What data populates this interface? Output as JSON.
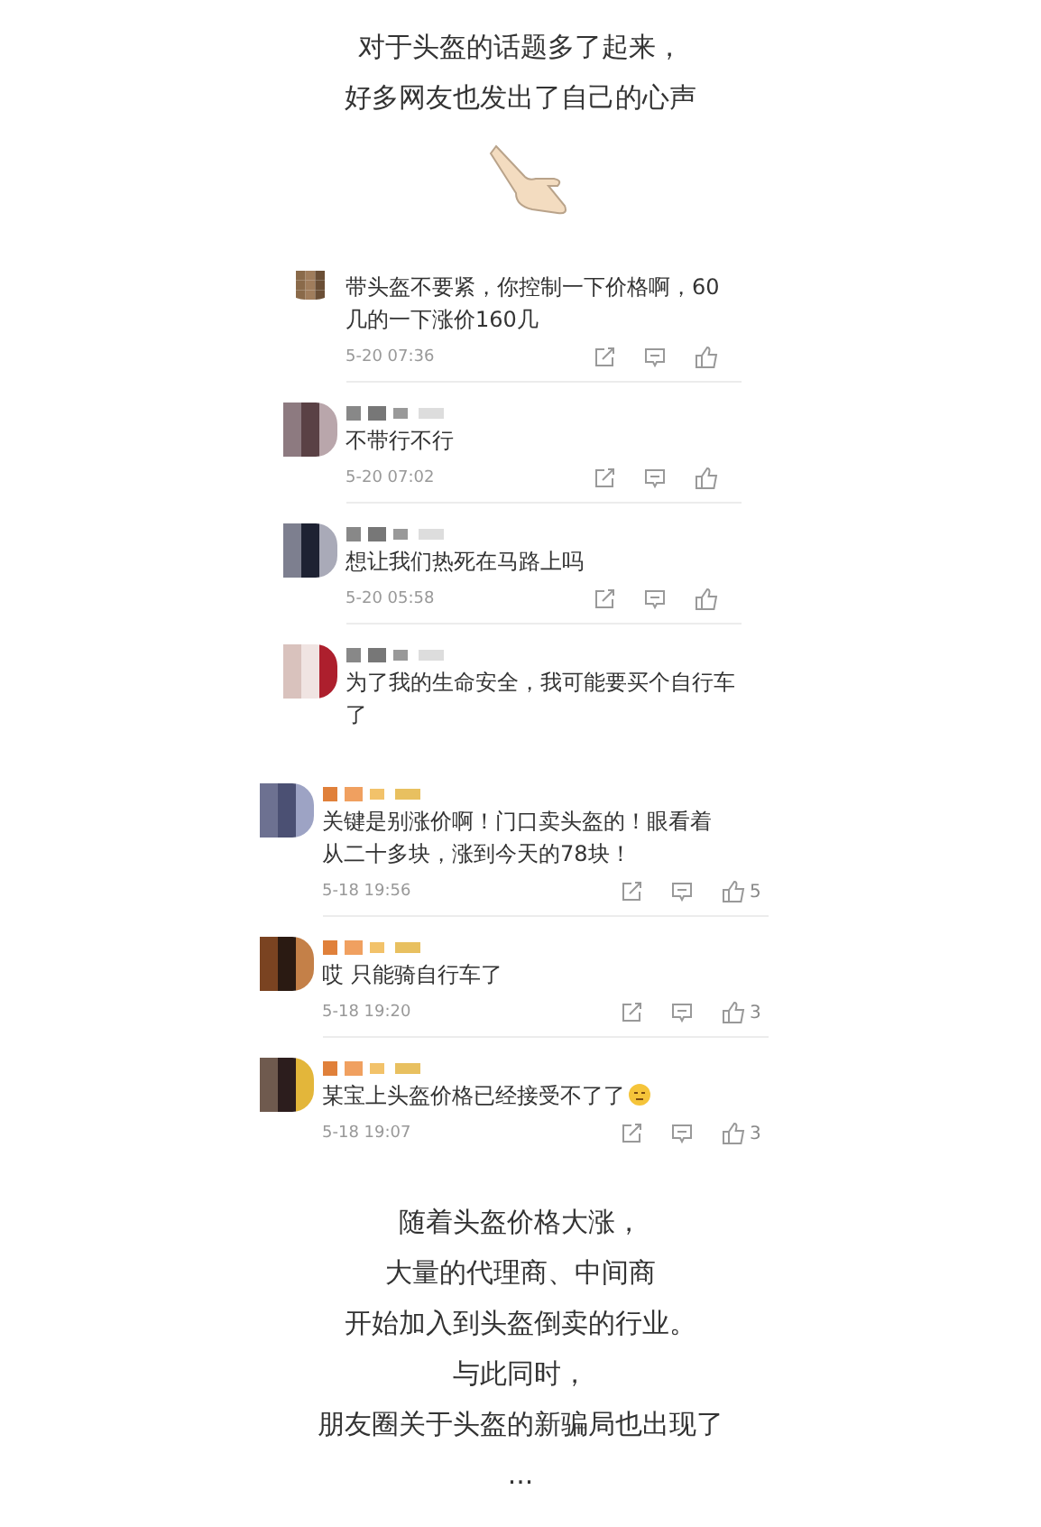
{
  "intro": [
    "对于头盔的话题多了起来，",
    "好多网友也发出了自己的心声"
  ],
  "comment_groups": [
    {
      "comments": [
        {
          "cropped": true,
          "text": "带头盔不要紧，你控制一下价格啊，60几的一下涨价160几",
          "time": "5-20 07:36"
        },
        {
          "cropped": false,
          "text": "不带行不行",
          "time": "5-20 07:02"
        },
        {
          "cropped": false,
          "text": "想让我们热死在马路上吗",
          "time": "5-20 05:58"
        },
        {
          "cropped": false,
          "text": "为了我的生命安全，我可能要买个自行车了"
        }
      ]
    },
    {
      "comments": [
        {
          "cropped": false,
          "text": "关键是别涨价啊！门口卖头盔的！眼看着从二十多块，涨到今天的78块！",
          "time": "5-18 19:56",
          "likes": "5"
        },
        {
          "cropped": false,
          "text": "哎 只能骑自行车了",
          "time": "5-18 19:20",
          "likes": "3"
        },
        {
          "cropped": false,
          "text": "某宝上头盔价格已经接受不了了",
          "trailing_emoji": true,
          "time": "5-18 19:07",
          "likes": "3"
        }
      ]
    }
  ],
  "outro": [
    "随着头盔价格大涨，",
    "大量的代理商、中间商",
    "开始加入到头盔倒卖的行业。",
    "与此同时，",
    "朋友圈关于头盔的新骗局也出现了",
    "..."
  ]
}
